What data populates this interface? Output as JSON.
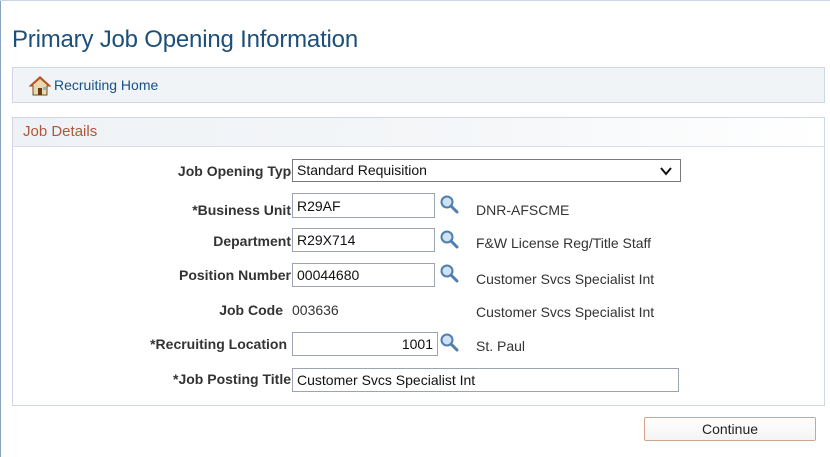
{
  "page": {
    "title": "Primary Job Opening Information"
  },
  "nav": {
    "home_label": "Recruiting Home"
  },
  "job_details": {
    "group_title": "Job Details",
    "job_opening_type": {
      "label": "Job Opening Type",
      "value": "Standard Requisition"
    },
    "business_unit": {
      "label": "*Business Unit",
      "value": "R29AF",
      "description": "DNR-AFSCME"
    },
    "department": {
      "label": "Department",
      "value": "R29X714",
      "description": "F&W License Reg/Title Staff"
    },
    "position_number": {
      "label": "Position Number",
      "value": "00044680",
      "description": "Customer Svcs Specialist Int"
    },
    "job_code": {
      "label": "Job Code",
      "value": "003636",
      "description": "Customer Svcs Specialist Int"
    },
    "recruiting_location": {
      "label": "*Recruiting Location",
      "value": "1001",
      "description": "St. Paul"
    },
    "job_posting_title": {
      "label": "*Job Posting Title",
      "value": "Customer Svcs Specialist Int"
    }
  },
  "actions": {
    "continue_label": "Continue"
  },
  "icons": {
    "home": "home-icon",
    "lookup": "magnifier-lookup-icon",
    "dropdown": "chevron-down-icon"
  },
  "colors": {
    "title": "#1d4f7a",
    "link": "#1a4f86",
    "group_title": "#b0573a"
  }
}
